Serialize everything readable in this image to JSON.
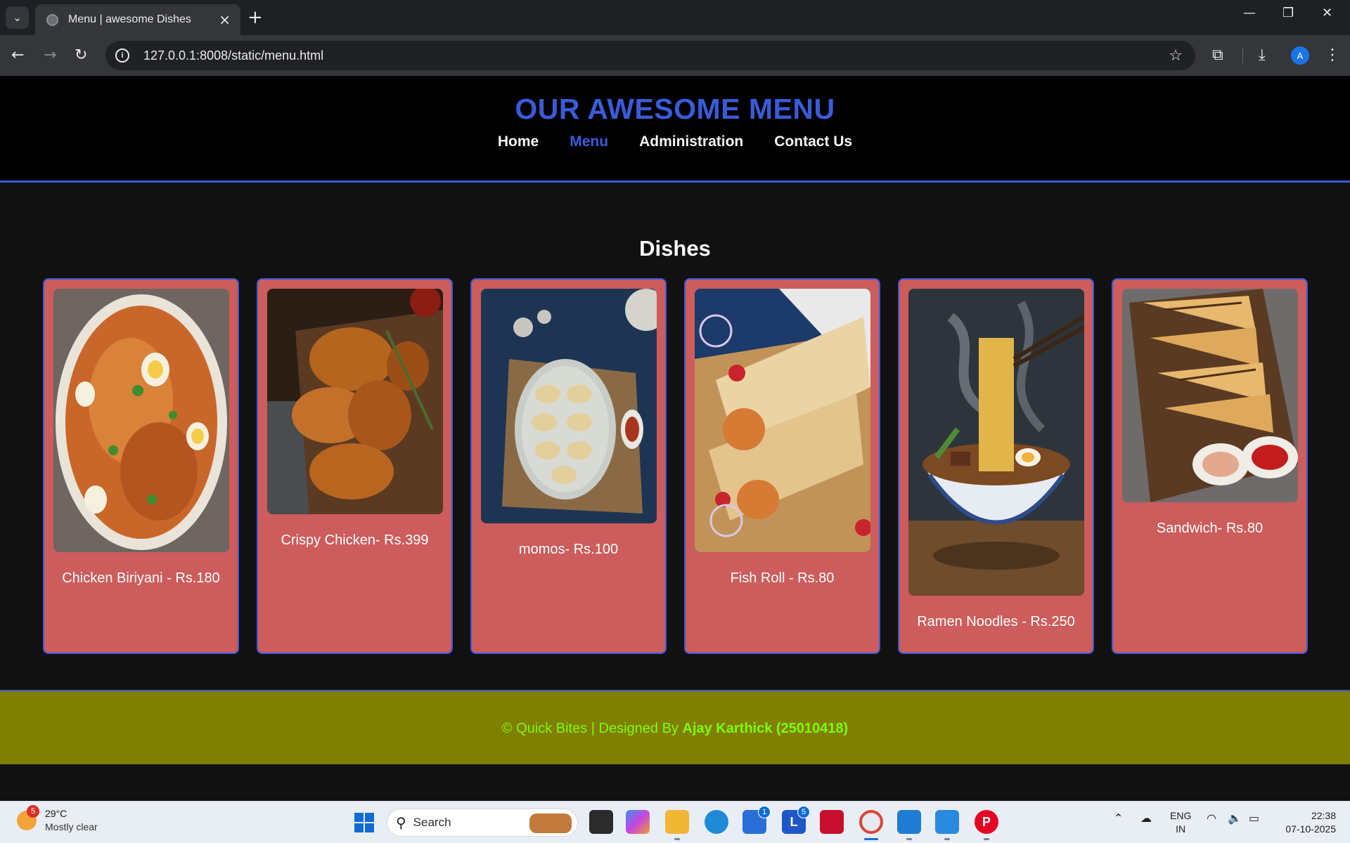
{
  "browser": {
    "tab_title": "Menu | awesome Dishes",
    "url": "127.0.0.1:8008/static/menu.html",
    "profile_initial": "A"
  },
  "site": {
    "title": "OUR AWESOME MENU",
    "nav": [
      {
        "label": "Home",
        "active": false
      },
      {
        "label": "Menu",
        "active": true
      },
      {
        "label": "Administration",
        "active": false
      },
      {
        "label": "Contact Us",
        "active": false
      }
    ],
    "section_title": "Dishes",
    "dishes": [
      {
        "name": "Chicken Biriyani - Rs.180",
        "image": "chicken-biriyani-photo"
      },
      {
        "name": "Crispy Chicken- Rs.399",
        "image": "crispy-chicken-photo"
      },
      {
        "name": "momos- Rs.100",
        "image": "momos-photo"
      },
      {
        "name": "Fish Roll - Rs.80",
        "image": "fish-roll-photo"
      },
      {
        "name": "Ramen Noodles - Rs.250",
        "image": "ramen-noodles-photo"
      },
      {
        "name": "Sandwich- Rs.80",
        "image": "sandwich-photo"
      }
    ],
    "footer": {
      "prefix": "© Quick Bites | Designed By ",
      "author": "Ajay Karthick (25010418)"
    },
    "colors": {
      "accent": "#3a5bd9",
      "card": "#cd5c5c",
      "footer_bg": "#808000",
      "footer_text": "#7cfc00"
    }
  },
  "taskbar": {
    "weather_temp": "29°C",
    "weather_desc": "Mostly clear",
    "weather_badge": "5",
    "search_placeholder": "Search",
    "store_badge": "1",
    "l_app_badge": "5",
    "lang_line1": "ENG",
    "lang_line2": "IN",
    "time": "22:38",
    "date": "07-10-2025"
  }
}
